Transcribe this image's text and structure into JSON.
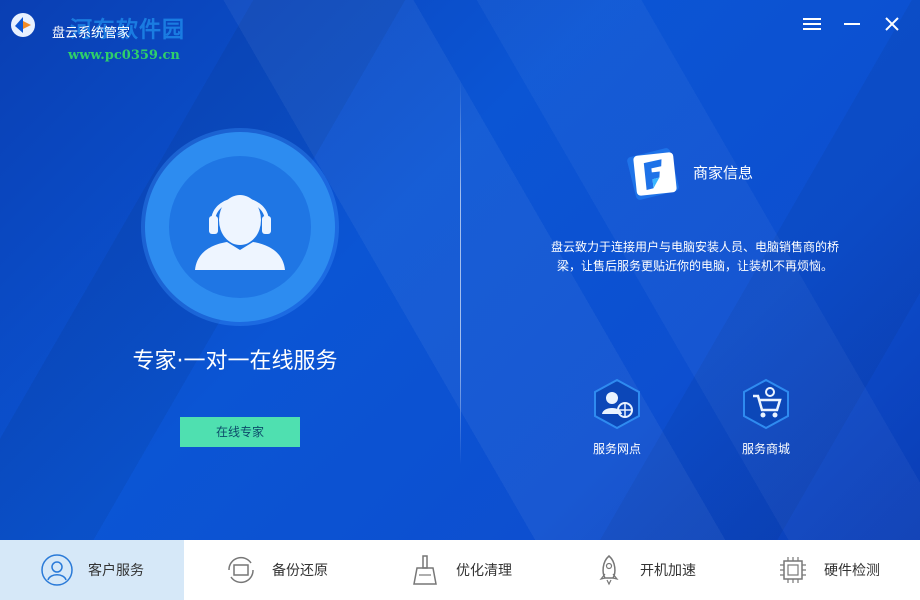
{
  "window": {
    "title": "盘云系统管家",
    "watermark": "河东软件园",
    "watermark_url": "www.pc0359.cn"
  },
  "left_panel": {
    "slogan": "专家·一对一在线服务",
    "online_button": "在线专家"
  },
  "merchant": {
    "title": "商家信息",
    "description_line1": "盘云致力于连接用户与电脑安装人员、电脑销售商的桥",
    "description_line2": "梁，让售后服务更贴近你的电脑，让装机不再烦恼。"
  },
  "services": [
    {
      "label": "服务网点",
      "icon": "service-outlet-icon"
    },
    {
      "label": "服务商城",
      "icon": "service-mall-icon"
    }
  ],
  "nav": [
    {
      "label": "客户服务",
      "icon": "customer-service-icon",
      "active": true
    },
    {
      "label": "备份还原",
      "icon": "backup-restore-icon",
      "active": false
    },
    {
      "label": "优化清理",
      "icon": "broom-icon",
      "active": false
    },
    {
      "label": "开机加速",
      "icon": "rocket-icon",
      "active": false
    },
    {
      "label": "硬件检测",
      "icon": "chip-icon",
      "active": false
    }
  ],
  "colors": {
    "accent_button": "#4fe0b0",
    "background": "#0b55d4",
    "nav_active": "#d6e8f8"
  }
}
